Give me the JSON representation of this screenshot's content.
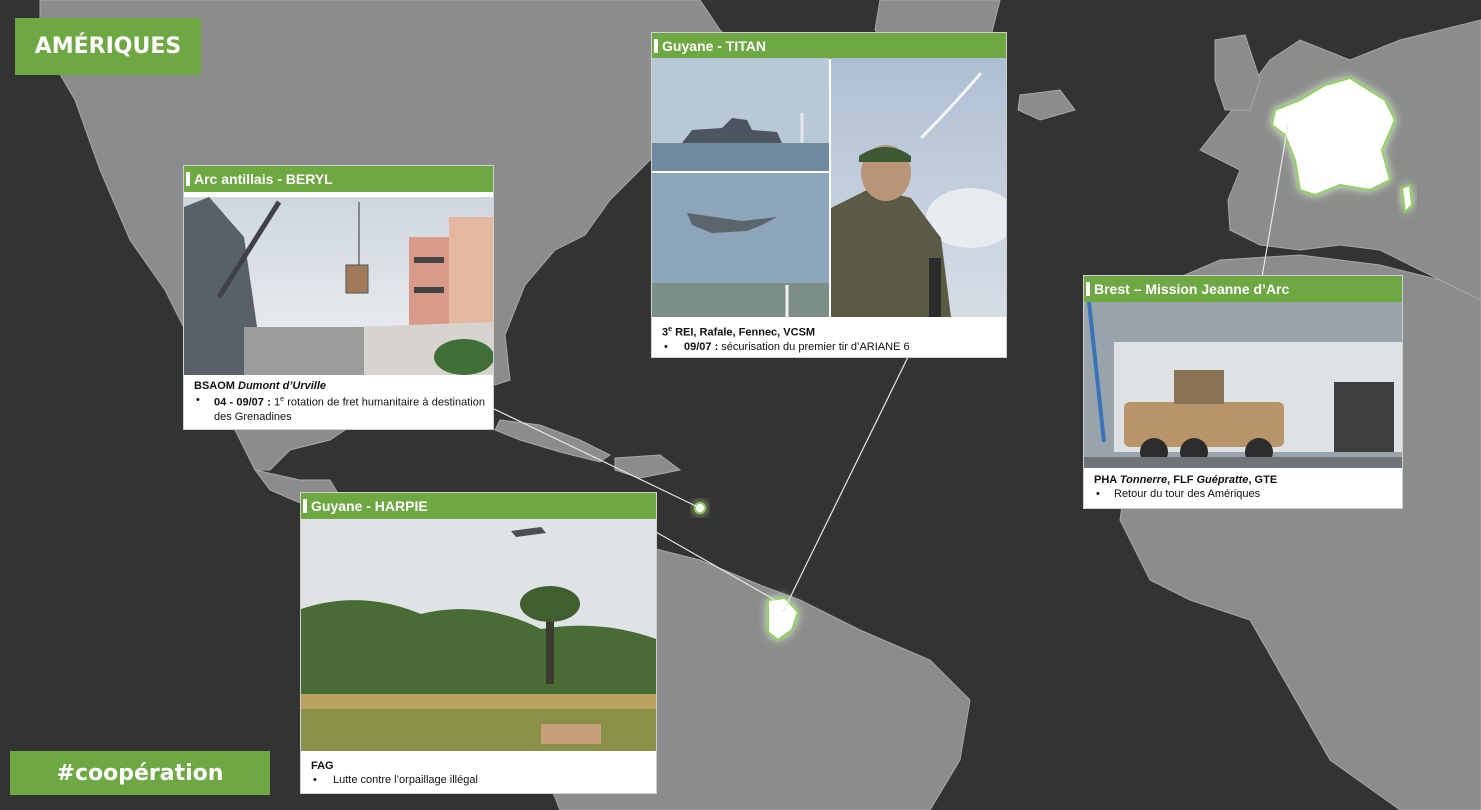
{
  "region_tag": "AMÉRIQUES",
  "hashtag": "#coopération",
  "colors": {
    "accent": "#6ea843",
    "ocean": "#333333",
    "land": "#8c8c8c",
    "highlight": "#ffffff"
  },
  "cards": {
    "beryl": {
      "header": "Arc antillais - BERYL",
      "title_prefix": "BSAOM ",
      "title_italic": "Dumont d’Urville",
      "bullet_bold": "04 - 09/07 :",
      "bullet_text_a": " 1",
      "bullet_sup": "e",
      "bullet_text_b": " rotation de fret humanitaire à destination des Grenadines"
    },
    "titan": {
      "header": "Guyane - TITAN",
      "title_a": "3",
      "title_sup": "e",
      "title_b": " REI, Rafale, Fennec,  VCSM",
      "bullet_bold": "09/07 :",
      "bullet_text": " sécurisation du premier tir d’ARIANE 6"
    },
    "harpie": {
      "header": "Guyane - HARPIE",
      "title": "FAG",
      "bullet_text": "Lutte contre l’orpaillage illégal"
    },
    "jeanne": {
      "header": "Brest – Mission Jeanne d’Arc",
      "t1": "PHA ",
      "t2": "Tonnerre",
      "t3": ", FLF ",
      "t4": "Guépratte",
      "t5": ", GTE",
      "bullet_text": "Retour du tour des Amériques"
    }
  }
}
